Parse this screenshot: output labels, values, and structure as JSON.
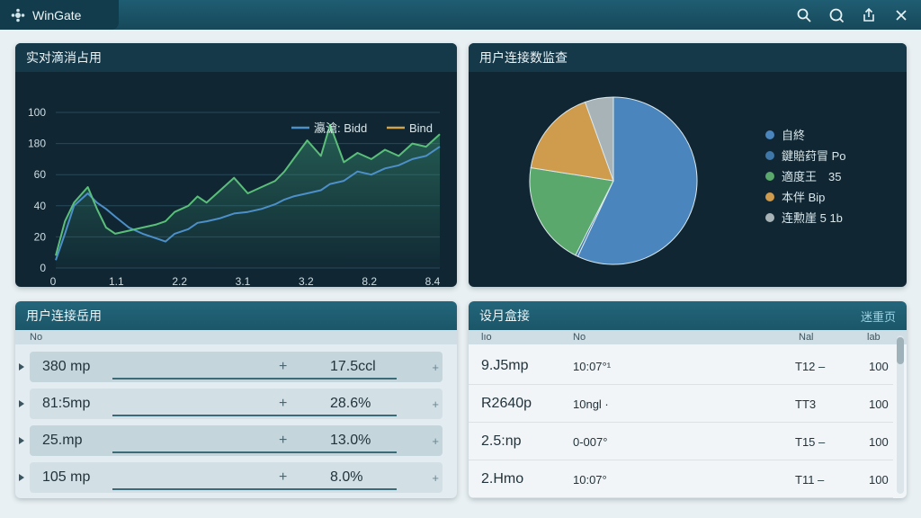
{
  "app": {
    "title": "WinGate"
  },
  "toolbar": {
    "icons": [
      "search-icon",
      "zoom-icon",
      "share-icon",
      "close-icon"
    ]
  },
  "traffic_panel": {
    "title": "实对滴消占用",
    "legend": [
      "瀛滄: Bidd",
      "Bind"
    ]
  },
  "pie_panel": {
    "title": "用户连接数监查",
    "legend": [
      "自終",
      "鍵賠荮冒 Po",
      "適度王　35",
      "本伴 Bip",
      "连勲崖 5 1b"
    ]
  },
  "usage_panel": {
    "title": "用户连接岳用",
    "column": "No",
    "rows": [
      {
        "name": "380 mp",
        "plus": "+",
        "pct": "17.5ccl",
        "arrow": "+"
      },
      {
        "name": "81:5mp",
        "plus": "+",
        "pct": "28.6%",
        "arrow": "+"
      },
      {
        "name": "25.mp",
        "plus": "+",
        "pct": "13.0%",
        "arrow": "+"
      },
      {
        "name": "105 mp",
        "plus": "+",
        "pct": "8.0%",
        "arrow": "+"
      }
    ]
  },
  "devices_panel": {
    "title": "设月盒接",
    "action": "迷重页",
    "columns": [
      "lıo",
      "No",
      "Nal",
      "lab"
    ],
    "rows": [
      {
        "c1": "9.J5mp",
        "c2": "10:07°¹",
        "c3": "T12 –",
        "c4": "100"
      },
      {
        "c1": "R2640p",
        "c2": "10ngl ·",
        "c3": "TT3",
        "c4": "100"
      },
      {
        "c1": "2.5:np",
        "c2": "0-007°",
        "c3": "T15 –",
        "c4": "100"
      },
      {
        "c1": "2.Hmo",
        "c2": "10:07°",
        "c3": "T11 –",
        "c4": "100"
      }
    ]
  },
  "chart_data": [
    {
      "type": "line",
      "title": "实对滴消占用",
      "x_ticks": [
        "0",
        "1.1",
        "2.2",
        "3.1",
        "3.2",
        "8.2",
        "8.4"
      ],
      "y_ticks": [
        "0",
        "20",
        "40",
        "60",
        "180",
        "100"
      ],
      "ylim": [
        0,
        100
      ],
      "xlim": [
        0,
        8.4
      ],
      "grid": true,
      "legend_position": "top-right",
      "series": [
        {
          "name": "瀛滄: Bidd",
          "color": "#4d8fc9",
          "x": [
            0,
            0.2,
            0.4,
            0.7,
            0.9,
            1.1,
            1.3,
            1.6,
            1.9,
            2.2,
            2.4,
            2.6,
            2.9,
            3.1,
            3.3,
            3.6,
            3.9,
            4.2,
            4.5,
            4.8,
            5.0,
            5.2,
            5.5,
            5.8,
            6.0,
            6.3,
            6.6,
            6.9,
            7.2,
            7.5,
            7.8,
            8.1,
            8.4
          ],
          "y": [
            5,
            22,
            40,
            48,
            42,
            38,
            33,
            26,
            22,
            19,
            17,
            22,
            25,
            29,
            30,
            32,
            35,
            36,
            38,
            41,
            44,
            46,
            48,
            50,
            54,
            56,
            62,
            60,
            64,
            66,
            70,
            72,
            78
          ]
        },
        {
          "name": "Bind",
          "color": "#d2a24c",
          "x": [
            0,
            0.2,
            0.4,
            0.7,
            0.9,
            1.1,
            1.3,
            1.6,
            1.9,
            2.2,
            2.4,
            2.6,
            2.9,
            3.1,
            3.3,
            3.6,
            3.9,
            4.2,
            4.5,
            4.8,
            5.0,
            5.2,
            5.5,
            5.8,
            6.0,
            6.3,
            6.6,
            6.9,
            7.2,
            7.5,
            7.8,
            8.1,
            8.4
          ],
          "y": [
            8,
            30,
            42,
            52,
            38,
            26,
            22,
            24,
            26,
            28,
            30,
            36,
            40,
            46,
            42,
            50,
            58,
            48,
            52,
            56,
            62,
            70,
            82,
            72,
            92,
            68,
            74,
            70,
            76,
            72,
            80,
            78,
            86
          ]
        }
      ]
    },
    {
      "type": "pie",
      "title": "用户连接数监查",
      "categories": [
        "自終",
        "鍵賠荮冒 Po",
        "適度王　35",
        "本伴 Bip",
        "连勲崖 5 1b"
      ],
      "values": [
        57,
        0.5,
        20,
        17,
        5.5
      ],
      "colors": [
        "#4a86bd",
        "#3f78a8",
        "#5aa86b",
        "#cf9b4c",
        "#a8b3b8"
      ]
    }
  ]
}
